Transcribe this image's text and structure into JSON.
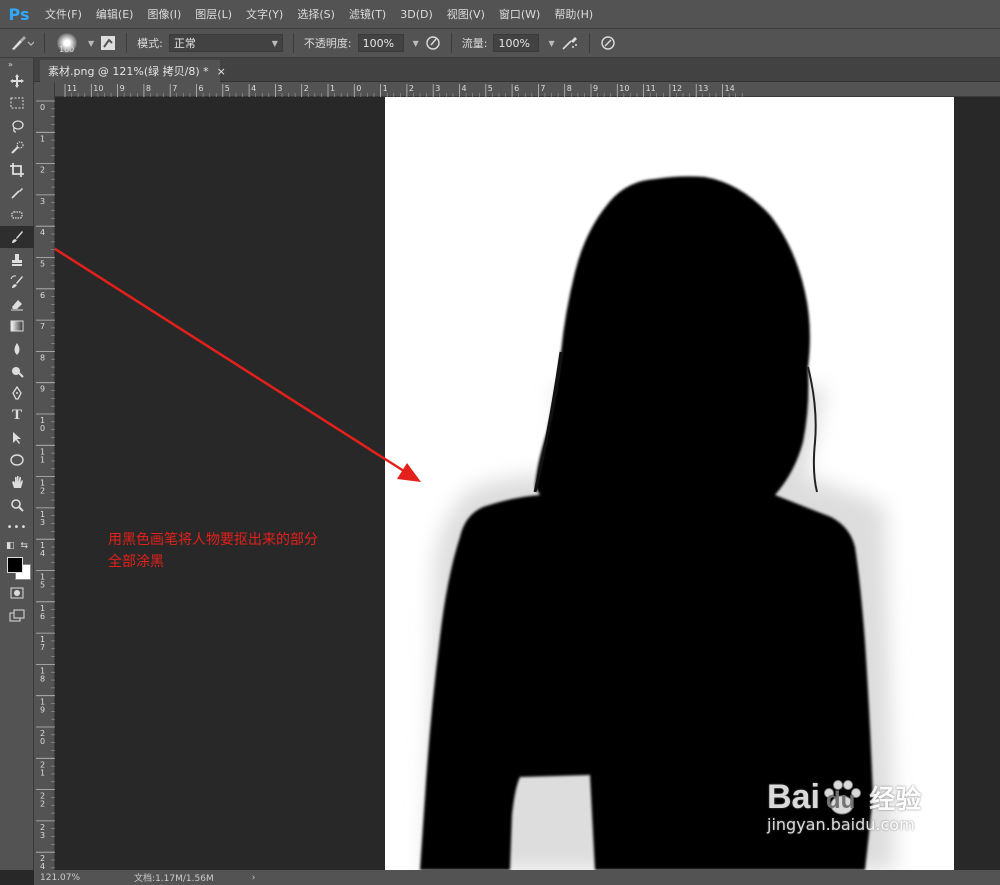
{
  "app": {
    "logo": "Ps"
  },
  "menu": [
    "文件(F)",
    "编辑(E)",
    "图像(I)",
    "图层(L)",
    "文字(Y)",
    "选择(S)",
    "滤镜(T)",
    "3D(D)",
    "视图(V)",
    "窗口(W)",
    "帮助(H)"
  ],
  "options": {
    "brush_size": "100",
    "mode_label": "模式:",
    "mode_value": "正常",
    "opacity_label": "不透明度:",
    "opacity_value": "100%",
    "flow_label": "流量:",
    "flow_value": "100%"
  },
  "document": {
    "tab_title": "素材.png @ 121%(绿 拷贝/8) *",
    "close": "×"
  },
  "ruler": {
    "h_labels": [
      "11",
      "10",
      "9",
      "8",
      "7",
      "6",
      "5",
      "4",
      "3",
      "2",
      "1",
      "0",
      "1",
      "2",
      "3",
      "4",
      "5",
      "6",
      "7",
      "8",
      "9",
      "10",
      "11",
      "12",
      "13",
      "14"
    ],
    "v_labels": [
      "0",
      "1",
      "2",
      "3",
      "4",
      "5",
      "6",
      "7",
      "8",
      "9",
      "10",
      "11",
      "12",
      "13",
      "14",
      "15",
      "16",
      "17",
      "18",
      "19",
      "20",
      "21",
      "22",
      "23",
      "24",
      "25"
    ]
  },
  "annotation": {
    "line1": "用黑色画笔将人物要抠出来的部分",
    "line2": "全部涂黑",
    "color": "#e3201b"
  },
  "status": {
    "zoom": "121.07%",
    "doc": "文档:1.17M/1.56M",
    "arrow": "›"
  },
  "watermark": {
    "brand": "Bai",
    "brand2": "du",
    "cn": "经验",
    "url": "jingyan.baidu.com"
  },
  "tools": [
    "move-icon",
    "marquee-icon",
    "lasso-icon",
    "quick-select-icon",
    "crop-icon",
    "eyedropper-icon",
    "healing-icon",
    "brush-icon",
    "stamp-icon",
    "history-brush-icon",
    "eraser-icon",
    "gradient-icon",
    "blur-icon",
    "dodge-icon",
    "pen-icon",
    "type-icon",
    "path-select-icon",
    "ellipse-icon",
    "hand-icon",
    "zoom-icon",
    "more-icon"
  ]
}
